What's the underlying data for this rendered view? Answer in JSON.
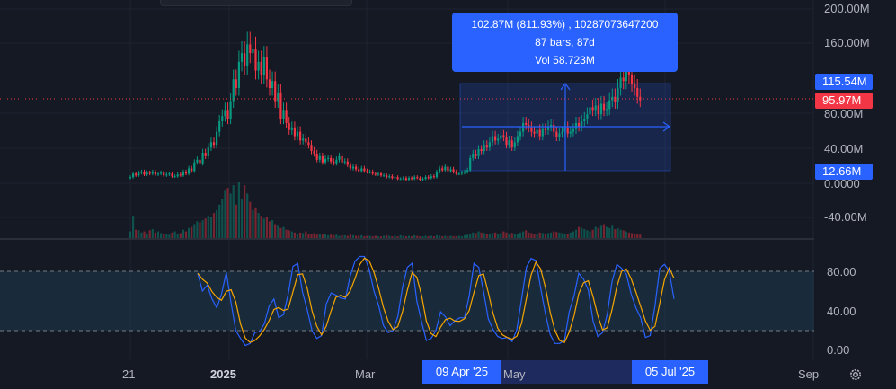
{
  "measurement": {
    "line1": "102.87M (811.93%) , 10287073647200",
    "line2": "87 bars, 87d",
    "line3": "Vol 58.723M"
  },
  "price_scale": {
    "ticks": [
      "200.00M",
      "160.00M",
      "80.00M",
      "40.00M",
      "0.0000",
      "-40.00M"
    ],
    "labels": {
      "range_high": "115.54M",
      "last_price": "95.97M",
      "range_low": "12.66M"
    }
  },
  "oscillator_scale": {
    "ticks": [
      "80.00",
      "40.00",
      "0.00"
    ]
  },
  "time_scale": {
    "ticks": [
      "21",
      "2025",
      "Mar",
      "May",
      "Sep"
    ],
    "range_start": "09 Apr '25",
    "range_end": "05 Jul '25"
  },
  "colors": {
    "background": "#151924",
    "up": "#089981",
    "down": "#f23645",
    "accent": "#2962ff",
    "k_line": "#2962ff",
    "d_line": "#f7a600"
  },
  "icons": {
    "settings": "gear-icon"
  },
  "chart_data": {
    "type": "candlestick",
    "start": 0,
    "candles": [
      [
        7,
        8
      ],
      [
        8,
        12
      ],
      [
        12,
        10
      ],
      [
        10,
        13
      ],
      [
        13,
        14
      ],
      [
        14,
        11
      ],
      [
        11,
        13
      ],
      [
        13,
        12
      ],
      [
        12,
        14
      ],
      [
        14,
        11
      ],
      [
        11,
        12
      ],
      [
        12,
        13
      ],
      [
        13,
        10
      ],
      [
        10,
        11
      ],
      [
        11,
        12
      ],
      [
        12,
        9
      ],
      [
        9,
        9
      ],
      [
        9,
        11
      ],
      [
        11,
        10
      ],
      [
        10,
        14
      ],
      [
        14,
        12
      ],
      [
        12,
        18
      ],
      [
        18,
        15
      ],
      [
        15,
        25
      ],
      [
        25,
        28
      ],
      [
        28,
        24
      ],
      [
        24,
        36
      ],
      [
        36,
        32
      ],
      [
        32,
        42
      ],
      [
        42,
        48
      ],
      [
        48,
        45
      ],
      [
        45,
        60
      ],
      [
        60,
        72
      ],
      [
        72,
        78
      ],
      [
        78,
        85
      ],
      [
        85,
        75
      ],
      [
        75,
        95
      ],
      [
        95,
        120
      ],
      [
        120,
        110
      ],
      [
        110,
        140
      ],
      [
        140,
        150
      ],
      [
        150,
        135
      ],
      [
        135,
        160
      ],
      [
        160,
        150
      ],
      [
        150,
        155
      ],
      [
        155,
        130
      ],
      [
        130,
        140
      ],
      [
        140,
        125
      ],
      [
        125,
        145
      ],
      [
        145,
        120
      ],
      [
        120,
        110
      ],
      [
        110,
        118
      ],
      [
        118,
        95
      ],
      [
        95,
        105
      ],
      [
        105,
        75
      ],
      [
        75,
        85
      ],
      [
        85,
        70
      ],
      [
        70,
        62
      ],
      [
        62,
        65
      ],
      [
        65,
        55
      ],
      [
        55,
        60
      ],
      [
        60,
        50
      ],
      [
        50,
        52
      ],
      [
        52,
        48
      ],
      [
        48,
        45
      ],
      [
        45,
        38
      ],
      [
        38,
        35
      ],
      [
        35,
        28
      ],
      [
        28,
        32
      ],
      [
        32,
        25
      ],
      [
        25,
        29
      ],
      [
        29,
        30
      ],
      [
        30,
        26
      ],
      [
        26,
        24
      ],
      [
        24,
        28
      ],
      [
        28,
        32
      ],
      [
        32,
        25
      ],
      [
        25,
        26
      ],
      [
        26,
        22
      ],
      [
        22,
        18
      ],
      [
        18,
        20
      ],
      [
        20,
        17
      ],
      [
        17,
        15
      ],
      [
        15,
        18
      ],
      [
        18,
        15
      ],
      [
        15,
        14
      ],
      [
        14,
        14
      ],
      [
        14,
        12
      ],
      [
        12,
        11
      ],
      [
        11,
        12
      ],
      [
        12,
        10
      ],
      [
        10,
        10
      ],
      [
        10,
        8
      ],
      [
        8,
        9
      ],
      [
        9,
        7
      ],
      [
        7,
        8
      ],
      [
        8,
        6
      ],
      [
        6,
        6
      ],
      [
        6,
        7
      ],
      [
        7,
        5
      ],
      [
        5,
        7
      ],
      [
        7,
        6
      ],
      [
        6,
        8
      ],
      [
        8,
        7
      ],
      [
        7,
        5
      ],
      [
        5,
        6
      ],
      [
        6,
        8
      ],
      [
        8,
        7
      ],
      [
        7,
        9
      ],
      [
        9,
        8
      ],
      [
        8,
        14
      ],
      [
        14,
        18
      ],
      [
        18,
        16
      ],
      [
        16,
        20
      ],
      [
        20,
        15
      ],
      [
        15,
        17
      ],
      [
        17,
        14
      ],
      [
        14,
        12
      ],
      [
        12,
        12
      ],
      [
        12,
        13
      ],
      [
        13,
        14
      ],
      [
        14,
        16
      ],
      [
        16,
        30
      ],
      [
        30,
        35
      ],
      [
        35,
        32
      ],
      [
        32,
        40
      ],
      [
        40,
        38
      ],
      [
        38,
        45
      ],
      [
        45,
        42
      ],
      [
        42,
        48
      ],
      [
        48,
        55
      ],
      [
        55,
        50
      ],
      [
        50,
        52
      ],
      [
        52,
        56
      ],
      [
        56,
        54
      ],
      [
        54,
        45
      ],
      [
        45,
        50
      ],
      [
        50,
        42
      ],
      [
        42,
        48
      ],
      [
        48,
        55
      ],
      [
        55,
        60
      ],
      [
        60,
        70
      ],
      [
        70,
        68
      ],
      [
        68,
        65
      ],
      [
        65,
        60
      ],
      [
        60,
        58
      ],
      [
        58,
        62
      ],
      [
        62,
        55
      ],
      [
        55,
        63
      ],
      [
        63,
        62
      ],
      [
        62,
        66
      ],
      [
        66,
        68
      ],
      [
        68,
        60
      ],
      [
        60,
        54
      ],
      [
        54,
        58
      ],
      [
        58,
        60
      ],
      [
        60,
        65
      ],
      [
        65,
        58
      ],
      [
        58,
        60
      ],
      [
        60,
        63
      ],
      [
        63,
        70
      ],
      [
        70,
        66
      ],
      [
        66,
        72
      ],
      [
        72,
        75
      ],
      [
        75,
        80
      ],
      [
        80,
        88
      ],
      [
        88,
        85
      ],
      [
        85,
        90
      ],
      [
        90,
        80
      ],
      [
        80,
        92
      ],
      [
        92,
        85
      ],
      [
        85,
        86
      ],
      [
        86,
        96
      ],
      [
        96,
        100
      ],
      [
        100,
        94
      ],
      [
        94,
        110
      ],
      [
        110,
        122
      ],
      [
        122,
        118
      ],
      [
        118,
        130
      ],
      [
        130,
        125
      ],
      [
        125,
        115
      ],
      [
        115,
        110
      ],
      [
        110,
        100
      ],
      [
        100,
        96
      ]
    ],
    "volume": [
      12,
      40,
      15,
      14,
      10,
      12,
      8,
      14,
      16,
      10,
      12,
      9,
      8,
      7,
      6,
      10,
      12,
      8,
      9,
      15,
      12,
      18,
      20,
      25,
      30,
      28,
      32,
      35,
      40,
      38,
      45,
      50,
      60,
      70,
      85,
      90,
      80,
      95,
      60,
      100,
      70,
      95,
      80,
      65,
      50,
      55,
      45,
      40,
      35,
      38,
      30,
      32,
      25,
      22,
      18,
      20,
      15,
      14,
      12,
      10,
      8,
      10,
      9,
      12,
      8,
      7,
      9,
      6,
      8,
      6,
      7,
      5,
      6,
      5,
      6,
      4,
      5,
      5,
      4,
      6,
      5,
      4,
      4,
      5,
      3,
      4,
      4,
      3,
      4,
      3,
      3,
      4,
      5,
      4,
      3,
      4,
      3,
      5,
      4,
      3,
      4,
      3,
      5,
      4,
      3,
      3,
      4,
      3,
      4,
      3,
      5,
      4,
      3,
      4,
      3,
      4,
      3,
      3,
      4,
      3,
      5,
      6,
      8,
      10,
      9,
      12,
      10,
      9,
      8,
      7,
      9,
      10,
      8,
      9,
      12,
      10,
      8,
      9,
      7,
      8,
      10,
      12,
      14,
      10,
      9,
      8,
      7,
      10,
      9,
      8,
      9,
      10,
      12,
      11,
      10,
      9,
      8,
      7,
      10,
      12,
      15,
      20,
      18,
      16,
      14,
      12,
      15,
      20,
      18,
      22,
      25,
      20,
      18,
      22,
      16,
      18,
      15,
      14,
      12,
      10,
      9,
      8,
      7,
      6,
      5,
      6,
      7,
      8,
      9,
      10
    ],
    "oscillator": {
      "upper_band": 80,
      "lower_band": 20,
      "k": [
        78,
        60,
        66,
        52,
        43,
        57,
        79,
        48,
        20,
        12,
        5,
        7,
        18,
        19,
        27,
        45,
        52,
        33,
        36,
        57,
        85,
        88,
        59,
        41,
        20,
        12,
        15,
        47,
        58,
        56,
        53,
        52,
        75,
        90,
        95,
        95,
        82,
        60,
        45,
        25,
        18,
        20,
        34,
        64,
        84,
        88,
        50,
        29,
        10,
        12,
        20,
        39,
        34,
        25,
        30,
        33,
        33,
        55,
        88,
        84,
        60,
        32,
        21,
        14,
        12,
        13,
        9,
        21,
        52,
        84,
        93,
        91,
        63,
        37,
        16,
        7,
        7,
        10,
        39,
        55,
        78,
        72,
        61,
        30,
        14,
        18,
        37,
        70,
        87,
        83,
        77,
        57,
        43,
        33,
        13,
        15,
        45,
        83,
        87,
        80,
        52
      ]
    }
  }
}
